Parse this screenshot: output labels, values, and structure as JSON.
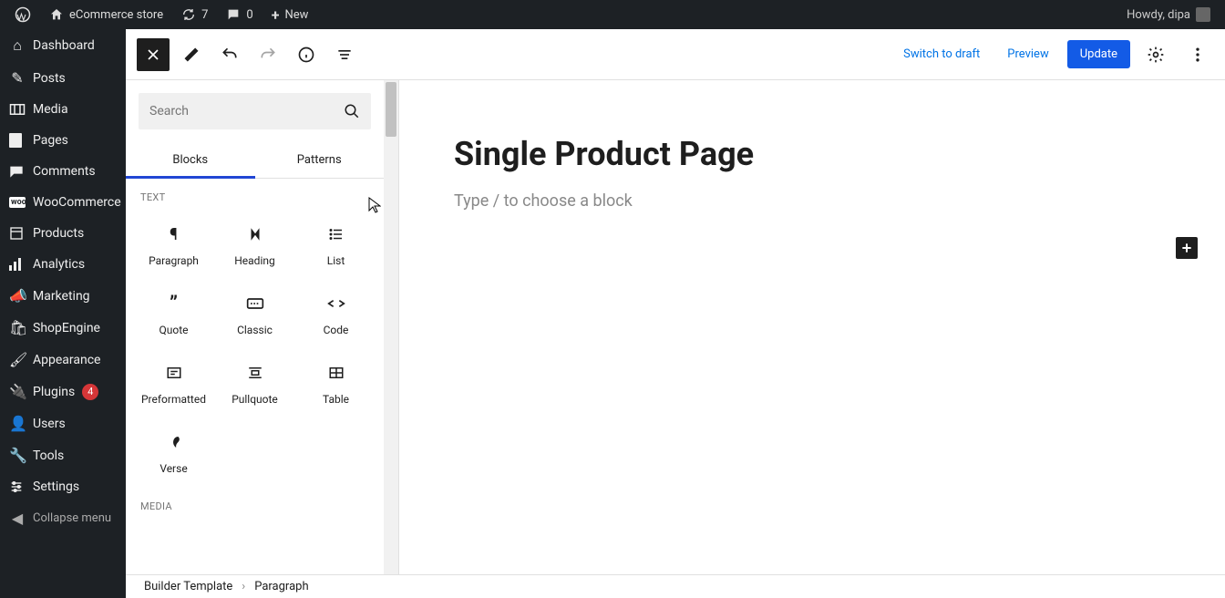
{
  "adminbar": {
    "site_name": "eCommerce store",
    "updates_count": "7",
    "comments_count": "0",
    "new_label": "New",
    "greeting": "Howdy, dipa"
  },
  "sidebar": {
    "items": [
      {
        "icon": "dashboard",
        "label": "Dashboard"
      },
      {
        "icon": "pin",
        "label": "Posts"
      },
      {
        "icon": "media",
        "label": "Media"
      },
      {
        "icon": "page",
        "label": "Pages"
      },
      {
        "icon": "comments",
        "label": "Comments"
      },
      {
        "icon": "woo",
        "label": "WooCommerce"
      },
      {
        "icon": "products",
        "label": "Products"
      },
      {
        "icon": "analytics",
        "label": "Analytics"
      },
      {
        "icon": "megaphone",
        "label": "Marketing"
      },
      {
        "icon": "shopengine",
        "label": "ShopEngine"
      },
      {
        "icon": "appearance",
        "label": "Appearance"
      },
      {
        "icon": "plugins",
        "label": "Plugins",
        "badge": "4"
      },
      {
        "icon": "users",
        "label": "Users"
      },
      {
        "icon": "tools",
        "label": "Tools"
      },
      {
        "icon": "settings",
        "label": "Settings"
      },
      {
        "icon": "collapse",
        "label": "Collapse menu"
      }
    ]
  },
  "toolbar": {
    "switch_label": "Switch to draft",
    "preview_label": "Preview",
    "update_label": "Update"
  },
  "inserter": {
    "search_placeholder": "Search",
    "tabs": [
      {
        "label": "Blocks",
        "active": true
      },
      {
        "label": "Patterns",
        "active": false
      }
    ],
    "sections": [
      {
        "title": "TEXT",
        "items": [
          {
            "icon": "paragraph",
            "label": "Paragraph"
          },
          {
            "icon": "heading",
            "label": "Heading"
          },
          {
            "icon": "list",
            "label": "List"
          },
          {
            "icon": "quote",
            "label": "Quote"
          },
          {
            "icon": "classic",
            "label": "Classic"
          },
          {
            "icon": "code",
            "label": "Code"
          },
          {
            "icon": "preformatted",
            "label": "Preformatted"
          },
          {
            "icon": "pullquote",
            "label": "Pullquote"
          },
          {
            "icon": "table",
            "label": "Table"
          },
          {
            "icon": "verse",
            "label": "Verse"
          }
        ]
      },
      {
        "title": "MEDIA",
        "items": []
      }
    ]
  },
  "canvas": {
    "page_title": "Single Product Page",
    "placeholder": "Type / to choose a block"
  },
  "breadcrumb": {
    "items": [
      "Builder Template",
      "Paragraph"
    ]
  }
}
